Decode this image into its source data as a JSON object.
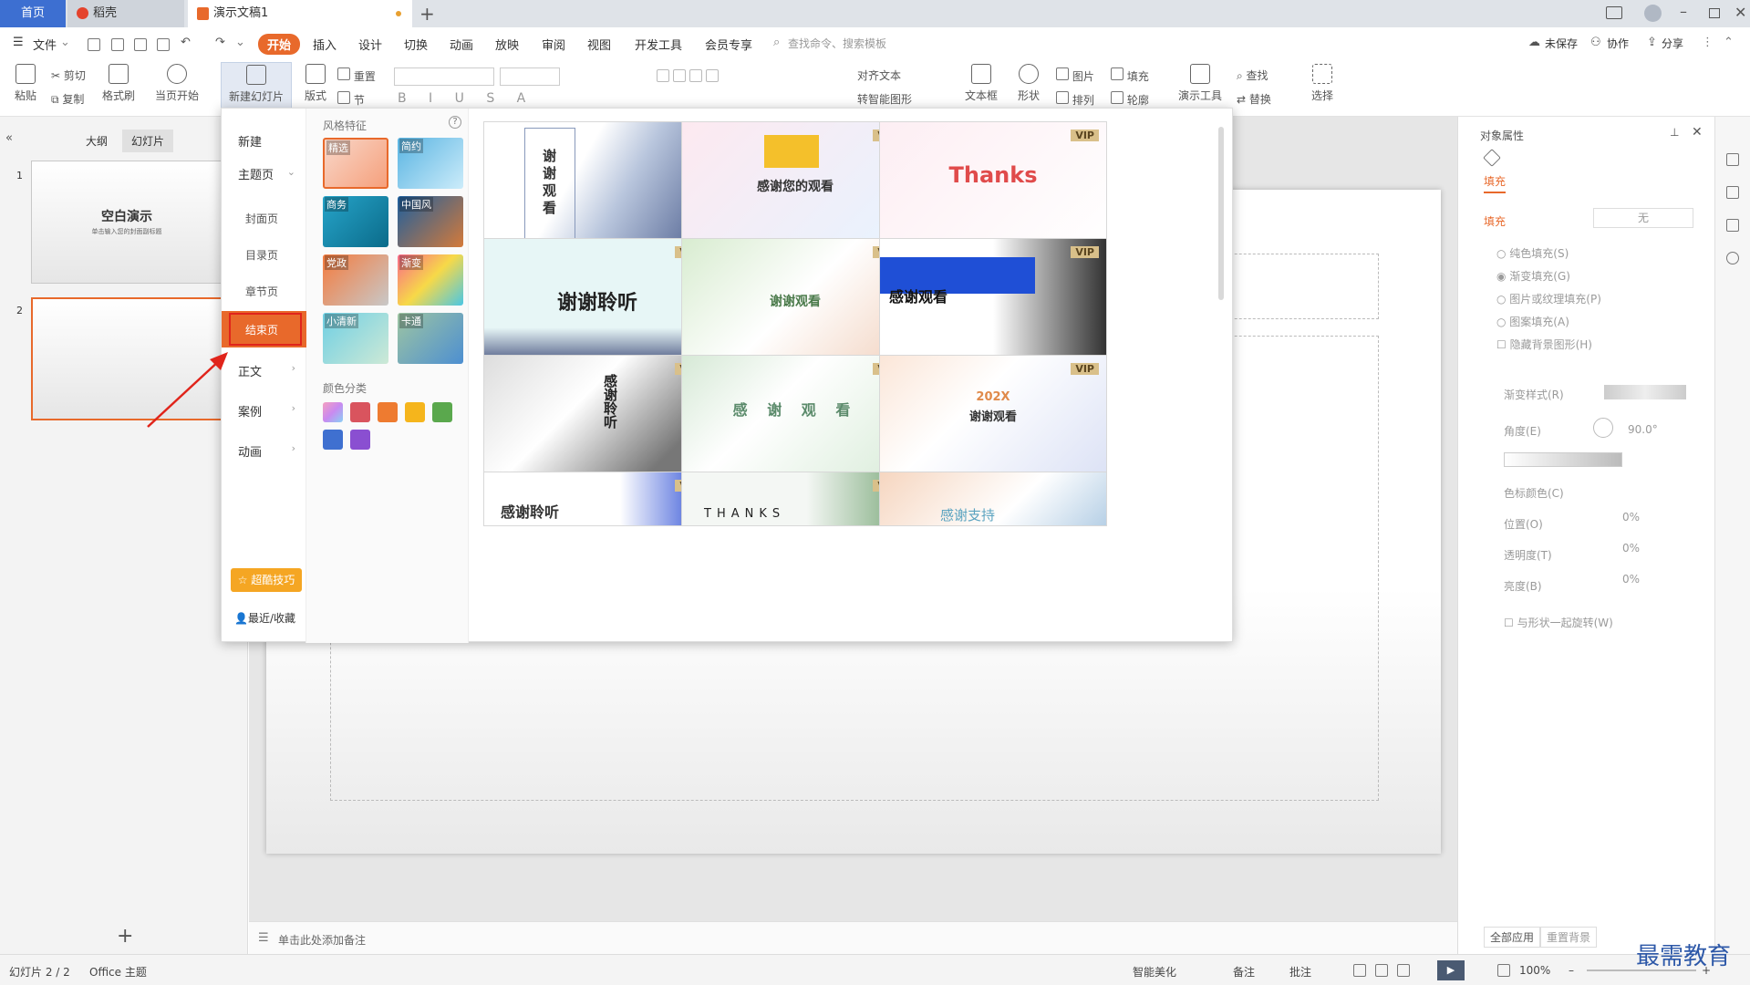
{
  "tabs": {
    "home": "首页",
    "daoke": "稻壳",
    "doc": "演示文稿1"
  },
  "menubar": {
    "file": "文件",
    "start": "开始",
    "insert": "插入",
    "design": "设计",
    "transition": "切换",
    "animation": "动画",
    "slideshow": "放映",
    "review": "审阅",
    "view": "视图",
    "devtools": "开发工具",
    "member": "会员专享",
    "search_placeholder": "查找命令、搜索模板",
    "unsaved": "未保存",
    "collab": "协作",
    "share": "分享"
  },
  "ribbon": {
    "paste": "粘贴",
    "cut": "剪切",
    "copy": "复制",
    "format_painter": "格式刷",
    "from_current": "当页开始",
    "new_slide": "新建幻灯片",
    "layout": "版式",
    "section": "节",
    "reset": "重置",
    "align_text": "对齐文本",
    "smart_graphic": "转智能图形",
    "textbox": "文本框",
    "shape": "形状",
    "picture": "图片",
    "fill": "填充",
    "arrange": "排列",
    "outline": "轮廓",
    "present_tools": "演示工具",
    "find": "查找",
    "replace": "替换",
    "select": "选择"
  },
  "left_pane": {
    "outline_tab": "大纲",
    "slides_tab": "幻灯片",
    "slide1_title": "空白演示",
    "slide1_sub": "单击输入您的封面副标题",
    "slide1_num": "1",
    "slide2_num": "2"
  },
  "dropdown": {
    "nav": {
      "new": "新建",
      "theme_page": "主题页",
      "cover": "封面页",
      "toc": "目录页",
      "chapter": "章节页",
      "ending": "结束页",
      "body": "正文",
      "cases": "案例",
      "animation": "动画",
      "tips": "超酷技巧",
      "recent": "最近/收藏"
    },
    "style_header": "风格特征",
    "styles": [
      "精选",
      "简约",
      "商务",
      "中国风",
      "党政",
      "渐变",
      "小清新",
      "卡通"
    ],
    "color_header": "颜色分类",
    "colors": [
      "#e77fd9",
      "#d9545e",
      "#ee7b30",
      "#f5b51c",
      "#5aa84d",
      "#3f70d0",
      "#8a4fd1"
    ],
    "vip_label": "VIP",
    "templates": [
      {
        "title": "谢谢观看"
      },
      {
        "title": "感谢您的观看"
      },
      {
        "title": "Thanks"
      },
      {
        "title": "谢谢聆听"
      },
      {
        "title": "谢谢观看"
      },
      {
        "title": "感谢观看"
      },
      {
        "title": "感谢聆听"
      },
      {
        "title": "感 谢 观 看"
      },
      {
        "title": "谢谢观看",
        "year": "202X"
      },
      {
        "title": "感谢聆听"
      },
      {
        "title": "THANKS"
      },
      {
        "title": "感谢支持"
      }
    ]
  },
  "notes_placeholder": "单击此处添加备注",
  "right_pane": {
    "title": "对象属性",
    "fill_tab": "填充",
    "fill_section": "填充",
    "fill_value": "无",
    "options": [
      "纯色填充(S)",
      "渐变填充(G)",
      "图片或纹理填充(P)",
      "图案填充(A)",
      "隐藏背景图形(H)"
    ],
    "gradient_style": "渐变样式(R)",
    "angle": "角度(E)",
    "angle_value": "90.0°",
    "stop_color": "色标颜色(C)",
    "position": "位置(O)",
    "transparency": "透明度(T)",
    "brightness": "亮度(B)",
    "percent": "0%",
    "rotate_with_shape": "与形状一起旋转(W)",
    "apply_all": "全部应用",
    "reset_bg": "重置背景"
  },
  "status": {
    "slide_info": "幻灯片 2 / 2",
    "theme": "Office 主题",
    "smart_beautify": "智能美化",
    "notes": "备注",
    "comments": "批注",
    "zoom": "100%"
  },
  "watermark": "最需教育"
}
